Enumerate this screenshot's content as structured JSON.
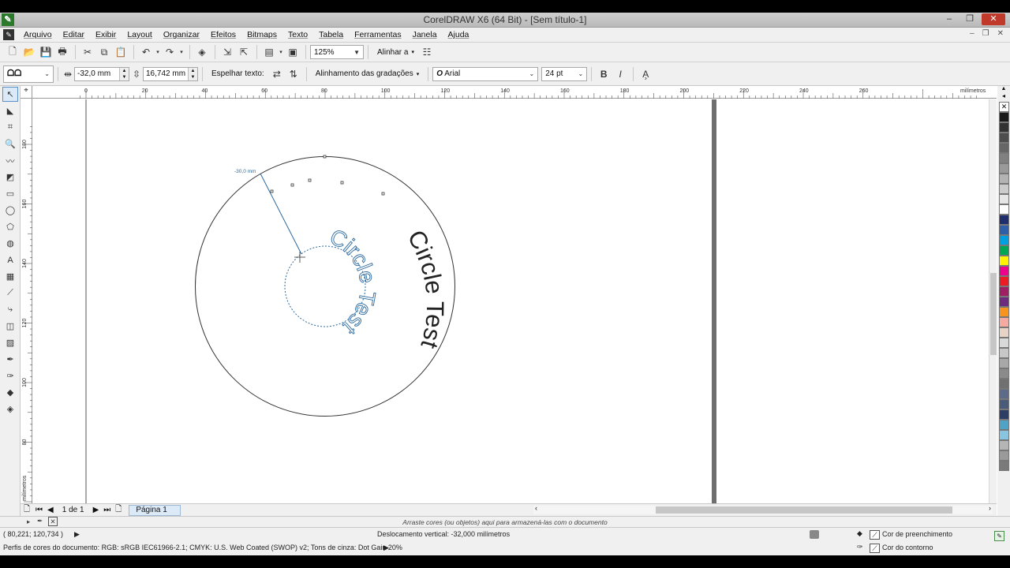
{
  "window": {
    "title": "CorelDRAW X6 (64 Bit) - [Sem título-1]",
    "minimize": "–",
    "restore": "❐",
    "close": "✕"
  },
  "menu": {
    "items": [
      "Arquivo",
      "Editar",
      "Exibir",
      "Layout",
      "Organizar",
      "Efeitos",
      "Bitmaps",
      "Texto",
      "Tabela",
      "Ferramentas",
      "Janela",
      "Ajuda"
    ]
  },
  "standard_toolbar": {
    "zoom": "125%",
    "snap_label": "Alinhar a"
  },
  "property_bar": {
    "offset_x": "-32,0 mm",
    "offset_y": "16,742 mm",
    "mirror_label": "Espelhar texto:",
    "align_label": "Alinhamento das gradações",
    "font_name": "Arial",
    "font_size": "24 pt"
  },
  "ruler": {
    "top_ticks": [
      "0",
      "20",
      "40",
      "60",
      "80",
      "100",
      "120",
      "140",
      "160",
      "180",
      "200",
      "220",
      "240",
      "260"
    ],
    "top_unit": "milímetros",
    "left_ticks": [
      "180",
      "160",
      "140",
      "120",
      "100",
      "80"
    ],
    "left_unit": "milímetros"
  },
  "canvas": {
    "outer_text": "Circle Test",
    "inner_text": "Circle Test",
    "dimension_label": "-30,0 mm"
  },
  "palette": {
    "colors": [
      "#1a1a1a",
      "#333333",
      "#4d4d4d",
      "#666666",
      "#808080",
      "#999999",
      "#b3b3b3",
      "#cccccc",
      "#e6e6e6",
      "#ffffff",
      "#1f2f6e",
      "#2e5fa8",
      "#00a0e0",
      "#00a651",
      "#fff200",
      "#ec008c",
      "#ed1c24",
      "#9e1f63",
      "#6d2d7e",
      "#f7941d",
      "#f5a9a0",
      "#e8d3c7",
      "#d9d9d9",
      "#c7c7c7",
      "#a8a8a8",
      "#8b8b8b",
      "#707070",
      "#5c6b8a",
      "#4a5a7a",
      "#2c3e66",
      "#4fa3c7",
      "#87c5e0",
      "#b5b5b5",
      "#9a9a9a",
      "#7a7a7a"
    ]
  },
  "navigator": {
    "page_count": "1 de 1",
    "page_tab": "Página 1"
  },
  "hint": {
    "text": "Arraste cores (ou objetos) aqui para armazená-las com o documento"
  },
  "status": {
    "coordinates": "( 80,221; 120,734 )",
    "message": "Deslocamento vertical: -32,000  milímetros",
    "fill_label": "Cor de preenchimento",
    "outline_label": "Cor do contorno",
    "color_profile": "Perfis de cores do documento: RGB: sRGB IEC61966-2.1; CMYK: U.S. Web Coated (SWOP) v2; Tons de cinza: Dot Gain 20%"
  }
}
